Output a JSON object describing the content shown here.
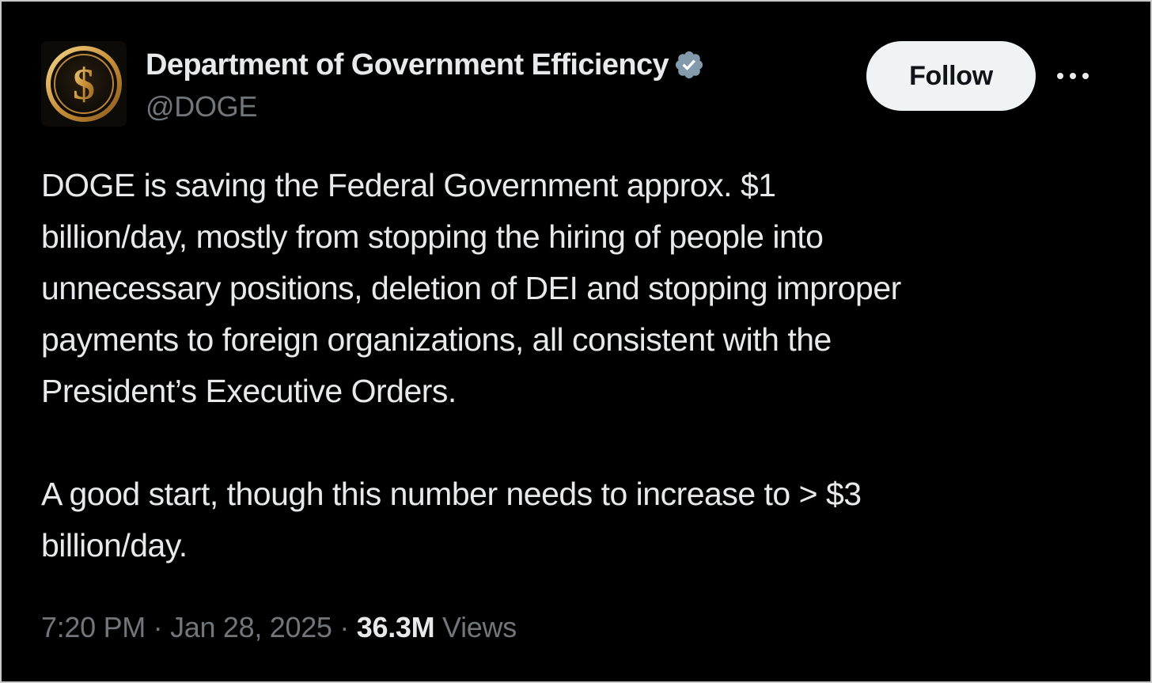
{
  "account": {
    "display_name": "Department of Government Efficiency",
    "handle": "@DOGE",
    "verified": true,
    "avatar_icon": "gold-dollar-coin-icon",
    "avatar_symbol": "$"
  },
  "actions": {
    "follow_label": "Follow",
    "more_icon": "more-horizontal-icon"
  },
  "tweet": {
    "paragraphs": [
      "DOGE is saving the Federal Government approx. $1\nbillion/day, mostly from stopping the hiring of people into\nunnecessary positions, deletion of DEI and stopping improper\npayments to foreign organizations, all consistent with the\nPresident’s Executive Orders.",
      "A good start, though this number needs to increase to > $3\nbillion/day."
    ],
    "time": "7:20 PM",
    "separator": "·",
    "date": "Jan 28, 2025",
    "views_count": "36.3M",
    "views_label": "Views"
  },
  "colors": {
    "background": "#000000",
    "text_primary": "#e7e9ea",
    "text_secondary": "#71767b",
    "follow_bg": "#eff3f4",
    "verified_badge": "#829aab",
    "avatar_gold": "#d4a24a"
  }
}
